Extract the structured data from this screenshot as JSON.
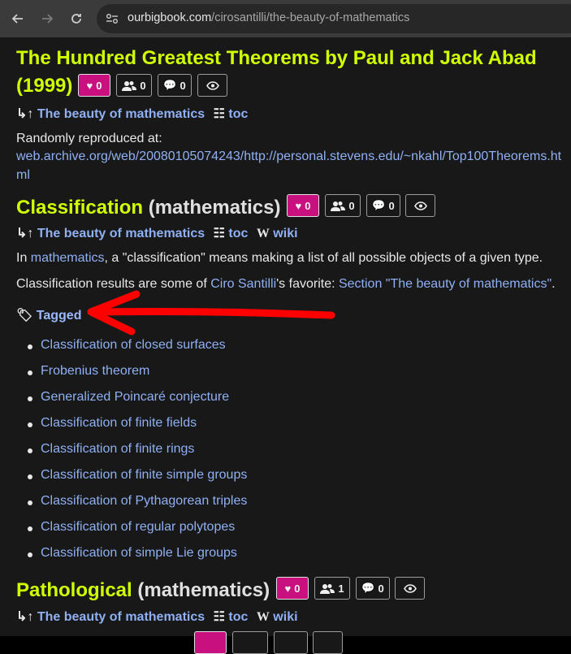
{
  "browser": {
    "url_host": "ourbigbook.com",
    "url_path": "/cirosantilli/the-beauty-of-mathematics"
  },
  "sections": [
    {
      "title": "The Hundred Greatest Theorems by Paul and Jack Abad",
      "title_line2": "(1999)",
      "likes": "0",
      "followers": "0",
      "comments": "0",
      "nav_parent": "The beauty of mathematics",
      "nav_toc": "toc"
    },
    {
      "title": "Classification",
      "title_rest": "(mathematics)",
      "likes": "0",
      "followers": "0",
      "comments": "0",
      "nav_parent": "The beauty of mathematics",
      "nav_toc": "toc",
      "nav_wiki": "wiki"
    },
    {
      "title": "Pathological",
      "title_rest": "(mathematics)",
      "likes": "0",
      "followers": "1",
      "comments": "0",
      "nav_parent": "The beauty of mathematics",
      "nav_toc": "toc",
      "nav_wiki": "wiki"
    }
  ],
  "reproduced": {
    "label": "Randomly reproduced at:",
    "url_line1": "web.archive.org/web/20080105074243/http://personal.stevens.edu/~nkahl/Top100Theorems.ht",
    "url_line2": "ml"
  },
  "classification": {
    "p1_pre": "In ",
    "p1_link": "mathematics",
    "p1_post": ", a \"classification\" means making a list of all possible objects of a given type.",
    "p2_pre": "Classification results are some of ",
    "p2_link1": "Ciro Santilli",
    "p2_mid": "'s favorite: ",
    "p2_link2": "Section \"The beauty of mathematics\"",
    "p2_post": ".",
    "tagged_label": "Tagged",
    "tagged": [
      "Classification of closed surfaces",
      "Frobenius theorem",
      "Generalized Poincaré conjecture",
      "Classification of finite fields",
      "Classification of finite rings",
      "Classification of finite simple groups",
      "Classification of Pythagorean triples",
      "Classification of regular polytopes",
      "Classification of simple Lie groups"
    ]
  },
  "colors": {
    "title": "#d0ff00",
    "link": "#8fb0f5",
    "like_bg": "#c8117f",
    "annotation_arrow": "#ff0000"
  }
}
